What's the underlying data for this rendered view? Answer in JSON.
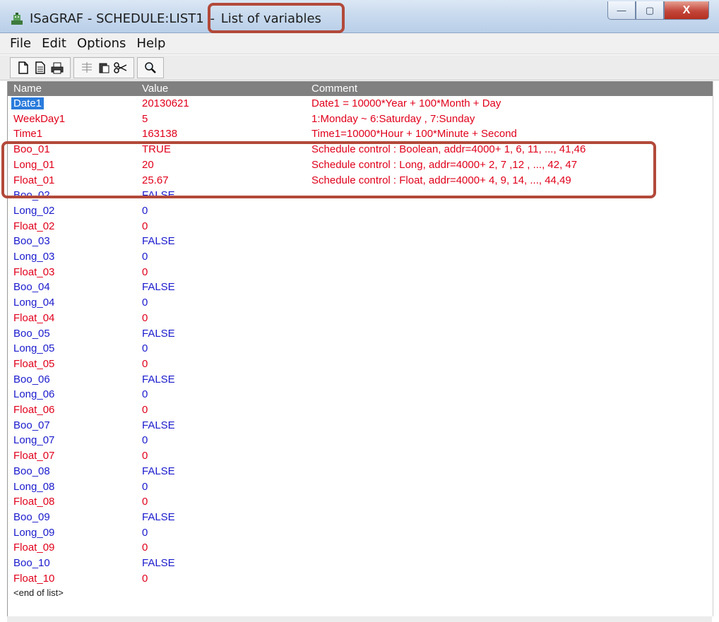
{
  "window": {
    "app_title": "ISaGRAF - SCHEDULE:LIST1",
    "separator": "-",
    "subtitle": "List of variables",
    "minimize_symbol": "—",
    "maximize_symbol": "▢",
    "close_symbol": "X"
  },
  "menu": [
    "File",
    "Edit",
    "Options",
    "Help"
  ],
  "toolbar": {
    "icons": [
      "new-doc-icon",
      "properties-icon",
      "print-icon",
      "insert-icon",
      "paste-icon",
      "cut-icon",
      "search-icon"
    ]
  },
  "table": {
    "headers": {
      "name": "Name",
      "value": "Value",
      "comment": "Comment"
    },
    "rows": [
      {
        "name": "Date1",
        "value": "20130621",
        "comment": "Date1 = 10000*Year + 100*Month + Day",
        "color": "red",
        "selected": true
      },
      {
        "name": "WeekDay1",
        "value": "5",
        "comment": "1:Monday  ~  6:Saturday , 7:Sunday",
        "color": "red"
      },
      {
        "name": "Time1",
        "value": "163138",
        "comment": "Time1=10000*Hour + 100*Minute + Second",
        "color": "red"
      },
      {
        "name": "Boo_01",
        "value": "TRUE",
        "comment": "Schedule control : Boolean, addr=4000+ 1, 6, 11, ..., 41,46",
        "color": "red"
      },
      {
        "name": "Long_01",
        "value": "20",
        "comment": "Schedule control : Long, addr=4000+ 2, 7 ,12 , ..., 42, 47",
        "color": "red"
      },
      {
        "name": "Float_01",
        "value": "25.67",
        "comment": "Schedule control : Float, addr=4000+ 4, 9, 14, ..., 44,49",
        "color": "red"
      },
      {
        "name": "Boo_02",
        "value": "FALSE",
        "comment": "",
        "color": "blue"
      },
      {
        "name": "Long_02",
        "value": "0",
        "comment": "",
        "color": "blue"
      },
      {
        "name": "Float_02",
        "value": "0",
        "comment": "",
        "color": "red"
      },
      {
        "name": "Boo_03",
        "value": "FALSE",
        "comment": "",
        "color": "blue"
      },
      {
        "name": "Long_03",
        "value": "0",
        "comment": "",
        "color": "blue"
      },
      {
        "name": "Float_03",
        "value": "0",
        "comment": "",
        "color": "red"
      },
      {
        "name": "Boo_04",
        "value": "FALSE",
        "comment": "",
        "color": "blue"
      },
      {
        "name": "Long_04",
        "value": "0",
        "comment": "",
        "color": "blue"
      },
      {
        "name": "Float_04",
        "value": "0",
        "comment": "",
        "color": "red"
      },
      {
        "name": "Boo_05",
        "value": "FALSE",
        "comment": "",
        "color": "blue"
      },
      {
        "name": "Long_05",
        "value": "0",
        "comment": "",
        "color": "blue"
      },
      {
        "name": "Float_05",
        "value": "0",
        "comment": "",
        "color": "red"
      },
      {
        "name": "Boo_06",
        "value": "FALSE",
        "comment": "",
        "color": "blue"
      },
      {
        "name": "Long_06",
        "value": "0",
        "comment": "",
        "color": "blue"
      },
      {
        "name": "Float_06",
        "value": "0",
        "comment": "",
        "color": "red"
      },
      {
        "name": "Boo_07",
        "value": "FALSE",
        "comment": "",
        "color": "blue"
      },
      {
        "name": "Long_07",
        "value": "0",
        "comment": "",
        "color": "blue"
      },
      {
        "name": "Float_07",
        "value": "0",
        "comment": "",
        "color": "red"
      },
      {
        "name": "Boo_08",
        "value": "FALSE",
        "comment": "",
        "color": "blue"
      },
      {
        "name": "Long_08",
        "value": "0",
        "comment": "",
        "color": "blue"
      },
      {
        "name": "Float_08",
        "value": "0",
        "comment": "",
        "color": "red"
      },
      {
        "name": "Boo_09",
        "value": "FALSE",
        "comment": "",
        "color": "blue"
      },
      {
        "name": "Long_09",
        "value": "0",
        "comment": "",
        "color": "blue"
      },
      {
        "name": "Float_09",
        "value": "0",
        "comment": "",
        "color": "red"
      },
      {
        "name": "Boo_10",
        "value": "FALSE",
        "comment": "",
        "color": "blue"
      },
      {
        "name": "Float_10",
        "value": "0",
        "comment": "",
        "color": "red"
      }
    ],
    "end_marker": "<end of list>"
  },
  "colors": {
    "red_text": "#e0001b",
    "blue_text": "#1a1acd",
    "header_bg": "#808080",
    "selection": "#2a7bdc",
    "annotation_box": "#b2493a"
  }
}
